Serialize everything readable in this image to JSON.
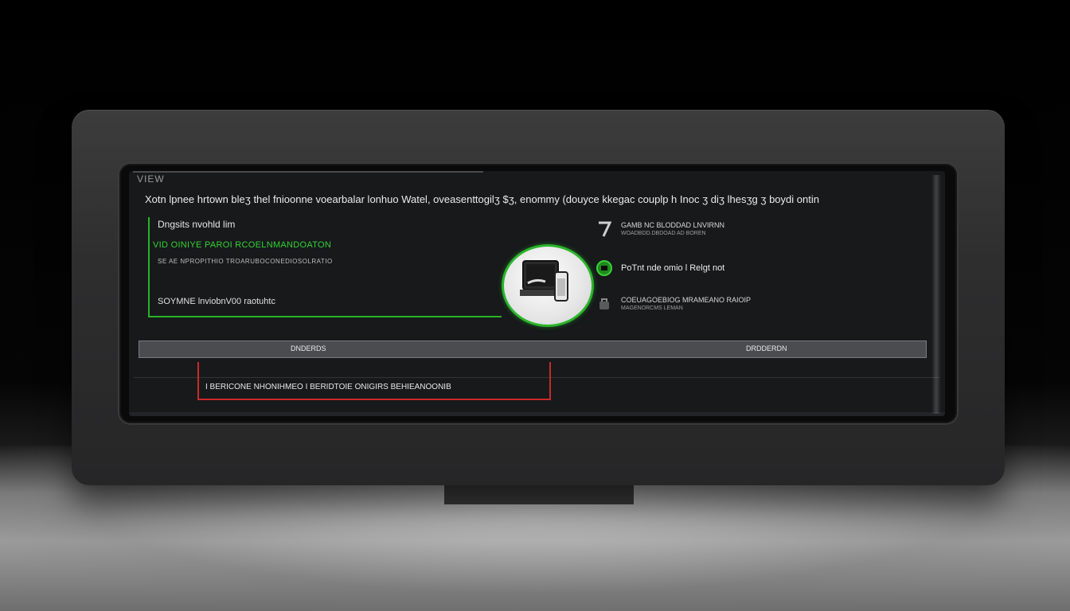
{
  "screen": {
    "logo": "VIEW",
    "headline": "Xotn lpnee hrtown bleʒ thel fnioonne voearbalar lonhuo Watel, oveasenttogilʒ $ʒ, enommy (douyce kkegac couplp h Inoc ʒ diʒ lhesʒg ʒ boydi ontin",
    "left_panel": {
      "title": "Dngsits nvohld lim",
      "green_line": "VID OINIYE PAROI RCOELNMANDOATON",
      "small_line": "SE AE NPROPITHIO TROARUBOCONEDIOSOLRATIO",
      "bottom_line": "SOYMNE   lnviobnV00 raotuhtc"
    },
    "center_icon": "computer-phone-icon",
    "right_items": [
      {
        "icon": "number-seven-icon",
        "main": "GAMB NC BLODDAD LNVIRNN",
        "sub": "WOADBDD.DBDOAD AD BOREN"
      },
      {
        "icon": "green-badge-icon",
        "main": "PoTnt nde omio l Relgt not",
        "sub": ""
      },
      {
        "icon": "bag-icon",
        "main": "COEUAGOEBIOG   MRAMEANO RAIOIP",
        "sub": "MAGENORCMS LEMAN"
      }
    ],
    "grey_bar": {
      "left_label": "DNDERDS",
      "right_label": "DRDDERDN"
    },
    "red_box_text": "I BERICONE NHONIHMEO    I BERIDTOIE ONIGIRS BEHIEANOONIB",
    "colors": {
      "accent_green": "#28b428",
      "accent_red": "#c92a2a",
      "screen_bg": "#17191b"
    }
  }
}
